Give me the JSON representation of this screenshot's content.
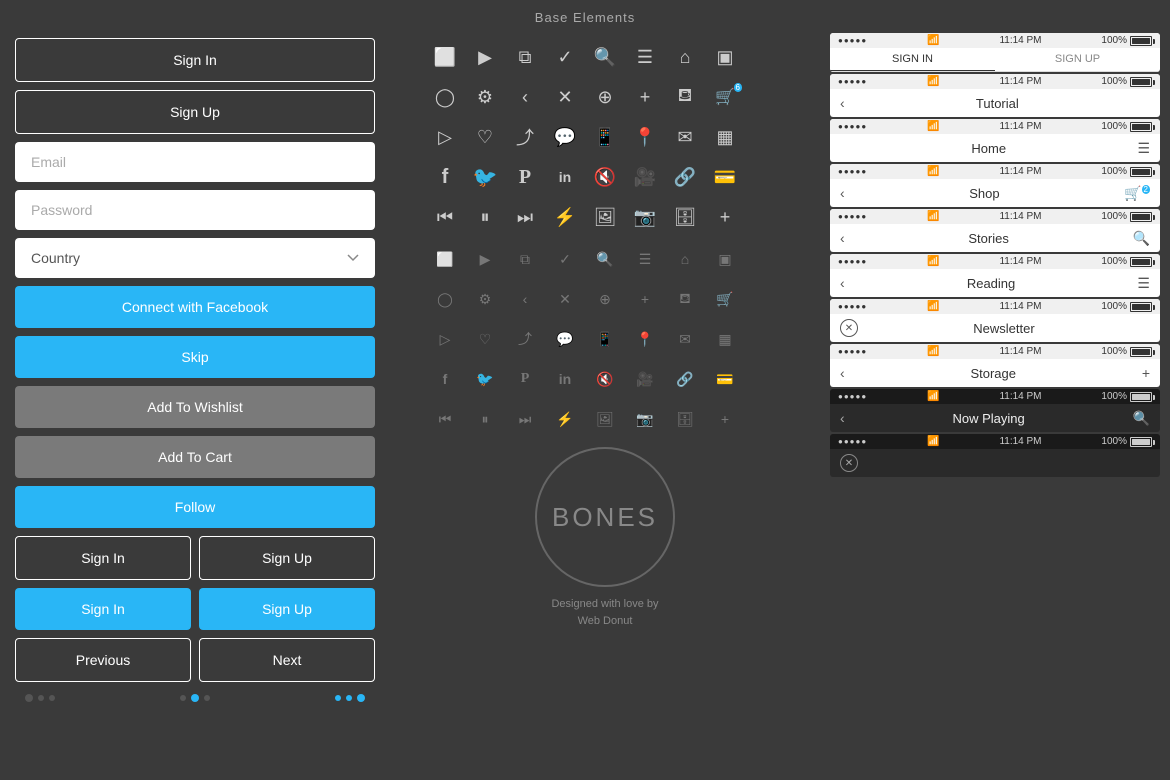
{
  "header": {
    "title": "Base Elements"
  },
  "left_panel": {
    "btn_sign_in": "Sign In",
    "btn_sign_up": "Sign Up",
    "email_placeholder": "Email",
    "password_placeholder": "Password",
    "country_label": "Country",
    "btn_facebook": "Connect with Facebook",
    "btn_skip": "Skip",
    "btn_wishlist": "Add To Wishlist",
    "btn_cart": "Add To Cart",
    "btn_follow": "Follow",
    "btn_signin_outline": "Sign In",
    "btn_signup_outline": "Sign Up",
    "btn_signin_blue": "Sign In",
    "btn_signup_blue": "Sign Up",
    "btn_previous": "Previous",
    "btn_next": "Next"
  },
  "middle_panel": {
    "bones_text": "BONES",
    "designed_line1": "Designed with love by",
    "designed_line2": "Web Donut"
  },
  "right_panel": {
    "screens": [
      {
        "type": "tabs",
        "time": "11:14 PM",
        "battery": "100%",
        "tabs": [
          "SIGN IN",
          "SIGN UP"
        ]
      },
      {
        "type": "nav",
        "time": "11:14 PM",
        "battery": "100%",
        "title": "Tutorial",
        "left_icon": "back",
        "right_icon": ""
      },
      {
        "type": "nav",
        "time": "11:14 PM",
        "battery": "100%",
        "title": "Home",
        "left_icon": "",
        "right_icon": "menu"
      },
      {
        "type": "nav",
        "time": "11:14 PM",
        "battery": "100%",
        "title": "Shop",
        "left_icon": "back",
        "right_icon": "cart"
      },
      {
        "type": "nav",
        "time": "11:14 PM",
        "battery": "100%",
        "title": "Stories",
        "left_icon": "back",
        "right_icon": "search"
      },
      {
        "type": "nav",
        "time": "11:14 PM",
        "battery": "100%",
        "title": "Reading",
        "left_icon": "back",
        "right_icon": "menu"
      },
      {
        "type": "nav",
        "dark": false,
        "time": "11:14 PM",
        "battery": "100%",
        "title": "Newsletter",
        "left_icon": "close",
        "right_icon": ""
      },
      {
        "type": "nav",
        "time": "11:14 PM",
        "battery": "100%",
        "title": "Storage",
        "left_icon": "back",
        "right_icon": "add"
      },
      {
        "type": "nav",
        "dark": true,
        "time": "11:14 PM",
        "battery": "100%",
        "title": "Now Playing",
        "left_icon": "back",
        "right_icon": "search"
      },
      {
        "type": "nav",
        "dark": true,
        "time": "11:14 PM",
        "battery": "100%",
        "title": "",
        "left_icon": "close",
        "right_icon": ""
      }
    ]
  },
  "colors": {
    "blue": "#29b6f6",
    "gray_bg": "#3a3a3a",
    "btn_gray": "#7a7a7a",
    "icon_light": "#cccccc",
    "icon_dark": "#666666"
  }
}
